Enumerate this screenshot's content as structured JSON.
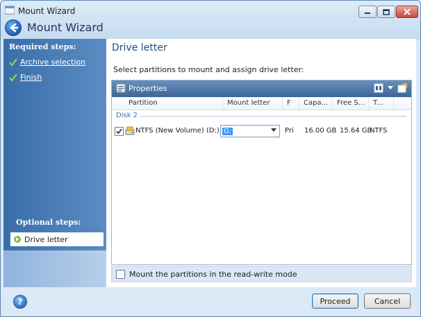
{
  "window": {
    "title": "Mount Wizard",
    "header_title": "Mount Wizard"
  },
  "sidebar": {
    "required_heading": "Required steps:",
    "required_items": [
      {
        "label": "Archive selection",
        "done": true
      },
      {
        "label": "Finish",
        "done": true
      }
    ],
    "optional_heading": "Optional steps:",
    "current_item": "Drive letter"
  },
  "content": {
    "page_title": "Drive letter",
    "instruction": "Select partitions to mount and assign drive letter:",
    "toolbar": {
      "properties_label": "Properties"
    },
    "columns": [
      "Partition",
      "Mount letter",
      "F",
      "Capa...",
      "Free S...",
      "T..."
    ],
    "group": "Disk 2",
    "rows": [
      {
        "checked": true,
        "partition": "NTFS (New Volume) (D:)",
        "mount_letter": "G:",
        "flags": "Pri",
        "capacity": "16.00 GB",
        "free_space": "15.64 GB",
        "type": "NTFS"
      }
    ],
    "readwrite_label": "Mount the partitions in the read-write mode",
    "readwrite_checked": false
  },
  "footer": {
    "proceed_label": "Proceed",
    "cancel_label": "Cancel"
  },
  "colors": {
    "sidebar": "#3a6ea8",
    "toolbar": "#4a74a6",
    "title_blue": "#1e4a7f",
    "selection": "#3399ff"
  }
}
